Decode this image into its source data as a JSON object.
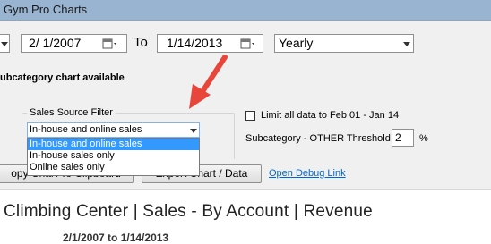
{
  "window": {
    "title": "Gym Pro Charts"
  },
  "dates": {
    "start": "2/  1/2007",
    "to_label": "To",
    "end": "1/14/2013"
  },
  "period": {
    "selected": "Yearly"
  },
  "notice": "ubcategory chart available",
  "source_filter": {
    "label": "Sales Source Filter",
    "selected": "In-house and online sales",
    "options": [
      "In-house and online sales",
      "In-house sales only",
      "Online sales only"
    ]
  },
  "limit": {
    "label": "Limit all data to Feb 01 - Jan 14",
    "checked": false
  },
  "threshold": {
    "label": "Subcategory - OTHER Threshold",
    "value": "2",
    "unit": "%"
  },
  "buttons": {
    "copy": "opy Chart To Clipboard",
    "export": "Export Chart / Data"
  },
  "debug_link": "Open Debug Link",
  "report": {
    "title": "Climbing Center | Sales - By Account | Revenue",
    "dates": "2/1/2007 to 1/14/2013"
  },
  "colors": {
    "titlebar": "#99b4d1",
    "arrow": "#e8463b",
    "link": "#0066cc",
    "selection": "#3399ff"
  }
}
